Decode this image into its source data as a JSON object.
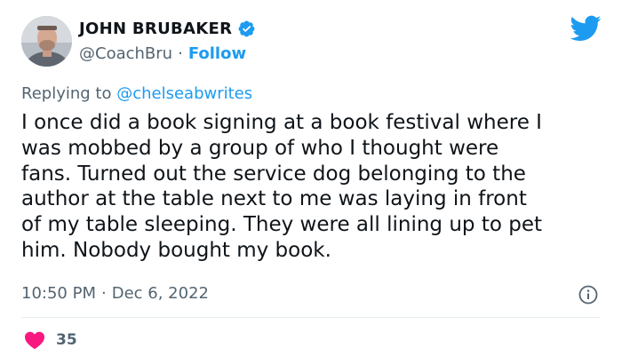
{
  "author": {
    "name": "JOHN BRUBAKER",
    "handle": "@CoachBru",
    "separator": "·",
    "follow_label": "Follow"
  },
  "reply": {
    "prefix": "Replying to ",
    "mention": "@chelseabwrites"
  },
  "tweet": {
    "text": "I once did a book signing at a book festival where I\nwas mobbed by a group of who I thought were\nfans. Turned out the service dog belonging to the\nauthor at the table next to me was laying in front\nof my table sleeping. They were all lining up to pet\nhim. Nobody bought my book.",
    "time": "10:50 PM",
    "separator": "·",
    "date": "Dec 6, 2022"
  },
  "engagement": {
    "likes": "35"
  },
  "icons": {
    "verified": "verified-badge-icon",
    "bird": "twitter-bird-icon",
    "info": "info-icon",
    "heart": "heart-icon"
  },
  "colors": {
    "accent": "#1d9bf0",
    "heart": "#f91880",
    "muted": "#536471",
    "text": "#0f1419"
  }
}
